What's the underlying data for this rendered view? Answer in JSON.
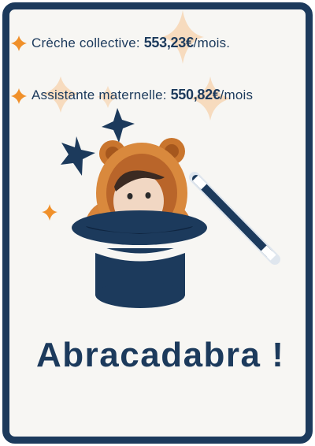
{
  "items": [
    {
      "label": "Crèche collective: ",
      "price": "553,23€",
      "unit": "/mois."
    },
    {
      "label": "Assistante maternelle: ",
      "price": "550,82€",
      "unit": "/mois"
    }
  ],
  "headline": "Abracadabra !",
  "illustration": {
    "subject": "baby-in-bear-hood",
    "icons": [
      "star-icon",
      "magician-hat-icon",
      "magic-wand-icon"
    ]
  },
  "colors": {
    "navy": "#1c3a5c",
    "orange": "#f0902a",
    "peach": "#f6d5b0",
    "background": "#f7f6f3"
  }
}
